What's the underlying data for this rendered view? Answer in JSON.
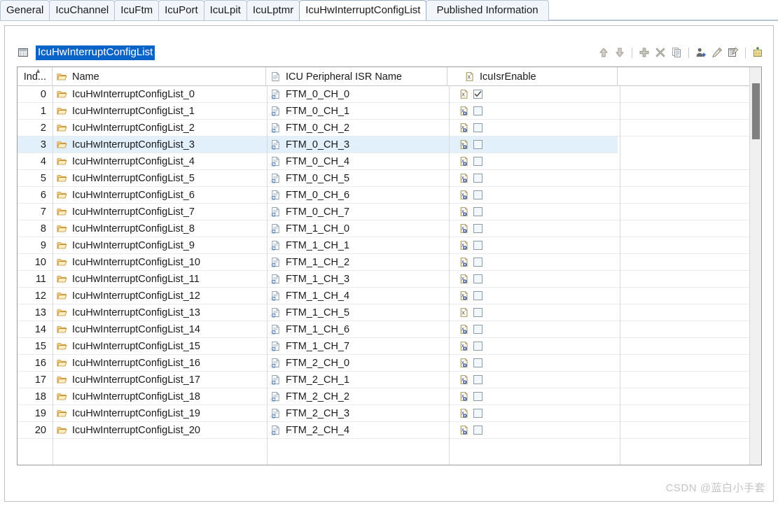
{
  "tabs": [
    {
      "label": "General",
      "active": false
    },
    {
      "label": "IcuChannel",
      "active": false
    },
    {
      "label": "IcuFtm",
      "active": false
    },
    {
      "label": "IcuPort",
      "active": false
    },
    {
      "label": "IcuLpit",
      "active": false
    },
    {
      "label": "IcuLptmr",
      "active": false
    },
    {
      "label": "IcuHwInterruptConfigList",
      "active": true
    },
    {
      "label": "Published Information",
      "active": false
    }
  ],
  "section": {
    "icon": "table-icon",
    "title": "IcuHwInterruptConfigList",
    "title_selected": true,
    "selection_color": "#0a64c8"
  },
  "toolbar": {
    "buttons": [
      {
        "name": "move-up-button",
        "icon": "arrow-up-icon",
        "label": "Move Up",
        "enabled": false
      },
      {
        "name": "move-down-button",
        "icon": "arrow-down-icon",
        "label": "Move Down",
        "enabled": false
      },
      {
        "name": "separator-1",
        "icon": "separator",
        "label": "",
        "enabled": false
      },
      {
        "name": "add-button",
        "icon": "plus-icon",
        "label": "Add",
        "enabled": false
      },
      {
        "name": "delete-button",
        "icon": "cross-icon",
        "label": "Delete",
        "enabled": false
      },
      {
        "name": "copy-button",
        "icon": "copy-icon",
        "label": "Copy",
        "enabled": false
      },
      {
        "name": "separator-2",
        "icon": "separator",
        "label": "",
        "enabled": false
      },
      {
        "name": "add-user-button",
        "icon": "user-add-icon",
        "label": "Add User",
        "enabled": true
      },
      {
        "name": "edit-button",
        "icon": "pencil-icon",
        "label": "Edit",
        "enabled": true
      },
      {
        "name": "edit-table-button",
        "icon": "edit-table-icon",
        "label": "Edit Table",
        "enabled": true
      },
      {
        "name": "separator-3",
        "icon": "separator",
        "label": "",
        "enabled": false
      },
      {
        "name": "import-table-button",
        "icon": "import-table-icon",
        "label": "Import Table",
        "enabled": true
      }
    ]
  },
  "table": {
    "columns": [
      {
        "key": "index",
        "label": "Ind...",
        "icon": "",
        "sort": "asc"
      },
      {
        "key": "name",
        "label": "Name",
        "icon": "folder-icon",
        "sort": ""
      },
      {
        "key": "isr",
        "label": "ICU Peripheral ISR Name",
        "icon": "document-icon",
        "sort": ""
      },
      {
        "key": "enable",
        "label": "IcuIsrEnable",
        "icon": "x-value-icon",
        "sort": ""
      },
      {
        "key": "last",
        "label": "",
        "icon": "",
        "sort": ""
      }
    ],
    "selected_row_index": 3,
    "rows": [
      {
        "index": "0",
        "name": "IcuHwInterruptConfigList_0",
        "isr": "FTM_0_CH_0",
        "value_icon": "x-icon",
        "checked": true
      },
      {
        "index": "1",
        "name": "IcuHwInterruptConfigList_1",
        "isr": "FTM_0_CH_1",
        "value_icon": "x-default-icon",
        "checked": false
      },
      {
        "index": "2",
        "name": "IcuHwInterruptConfigList_2",
        "isr": "FTM_0_CH_2",
        "value_icon": "x-default-icon",
        "checked": false
      },
      {
        "index": "3",
        "name": "IcuHwInterruptConfigList_3",
        "isr": "FTM_0_CH_3",
        "value_icon": "x-default-icon",
        "checked": false
      },
      {
        "index": "4",
        "name": "IcuHwInterruptConfigList_4",
        "isr": "FTM_0_CH_4",
        "value_icon": "x-default-icon",
        "checked": false
      },
      {
        "index": "5",
        "name": "IcuHwInterruptConfigList_5",
        "isr": "FTM_0_CH_5",
        "value_icon": "x-default-icon",
        "checked": false
      },
      {
        "index": "6",
        "name": "IcuHwInterruptConfigList_6",
        "isr": "FTM_0_CH_6",
        "value_icon": "x-default-icon",
        "checked": false
      },
      {
        "index": "7",
        "name": "IcuHwInterruptConfigList_7",
        "isr": "FTM_0_CH_7",
        "value_icon": "x-default-icon",
        "checked": false
      },
      {
        "index": "8",
        "name": "IcuHwInterruptConfigList_8",
        "isr": "FTM_1_CH_0",
        "value_icon": "x-default-icon",
        "checked": false
      },
      {
        "index": "9",
        "name": "IcuHwInterruptConfigList_9",
        "isr": "FTM_1_CH_1",
        "value_icon": "x-default-icon",
        "checked": false
      },
      {
        "index": "10",
        "name": "IcuHwInterruptConfigList_10",
        "isr": "FTM_1_CH_2",
        "value_icon": "x-default-icon",
        "checked": false
      },
      {
        "index": "11",
        "name": "IcuHwInterruptConfigList_11",
        "isr": "FTM_1_CH_3",
        "value_icon": "x-default-icon",
        "checked": false
      },
      {
        "index": "12",
        "name": "IcuHwInterruptConfigList_12",
        "isr": "FTM_1_CH_4",
        "value_icon": "x-default-icon",
        "checked": false
      },
      {
        "index": "13",
        "name": "IcuHwInterruptConfigList_13",
        "isr": "FTM_1_CH_5",
        "value_icon": "x-icon",
        "checked": false
      },
      {
        "index": "14",
        "name": "IcuHwInterruptConfigList_14",
        "isr": "FTM_1_CH_6",
        "value_icon": "x-default-icon",
        "checked": false
      },
      {
        "index": "15",
        "name": "IcuHwInterruptConfigList_15",
        "isr": "FTM_1_CH_7",
        "value_icon": "x-default-icon",
        "checked": false
      },
      {
        "index": "16",
        "name": "IcuHwInterruptConfigList_16",
        "isr": "FTM_2_CH_0",
        "value_icon": "x-default-icon",
        "checked": false
      },
      {
        "index": "17",
        "name": "IcuHwInterruptConfigList_17",
        "isr": "FTM_2_CH_1",
        "value_icon": "x-default-icon",
        "checked": false
      },
      {
        "index": "18",
        "name": "IcuHwInterruptConfigList_18",
        "isr": "FTM_2_CH_2",
        "value_icon": "x-default-icon",
        "checked": false
      },
      {
        "index": "19",
        "name": "IcuHwInterruptConfigList_19",
        "isr": "FTM_2_CH_3",
        "value_icon": "x-default-icon",
        "checked": false
      },
      {
        "index": "20",
        "name": "IcuHwInterruptConfigList_20",
        "isr": "FTM_2_CH_4",
        "value_icon": "x-default-icon",
        "checked": false
      }
    ]
  },
  "scrollbar": {
    "orientation": "vertical",
    "thumb_top_pct": 4,
    "thumb_height_pct": 14
  },
  "watermark": {
    "text": "CSDN @蓝白小手套"
  }
}
